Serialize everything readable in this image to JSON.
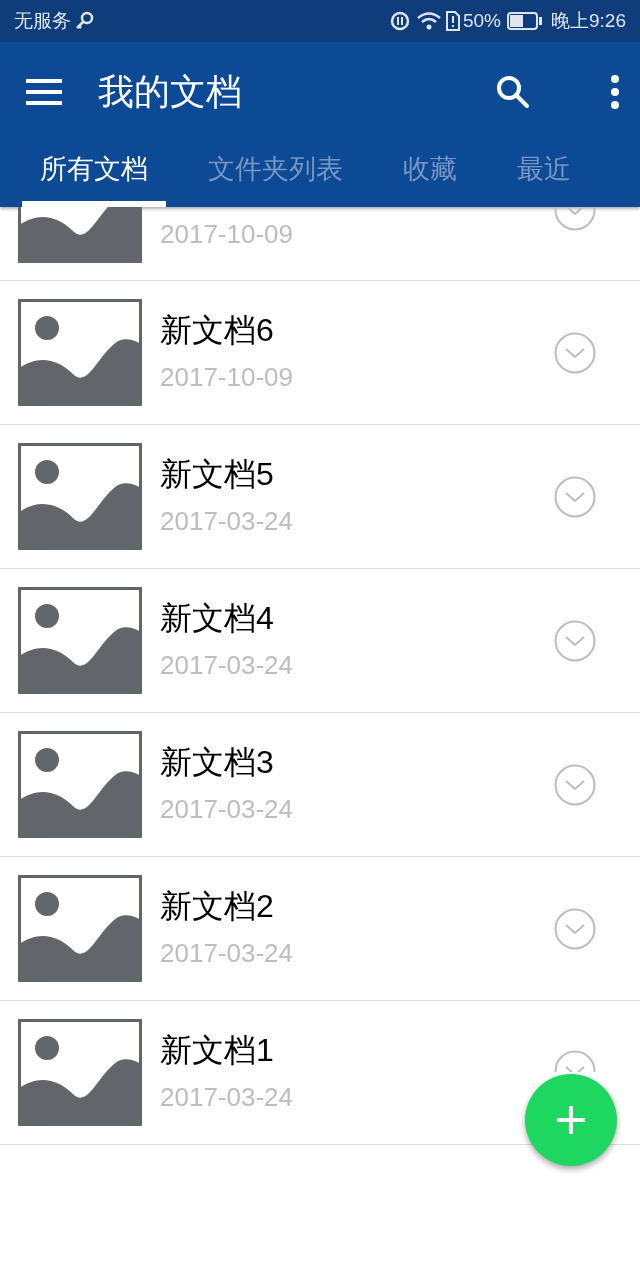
{
  "status_bar": {
    "carrier": "无服务",
    "battery": "50%",
    "time": "晚上9:26"
  },
  "app_bar": {
    "title": "我的文档"
  },
  "tabs": [
    {
      "label": "所有文档",
      "selected": true
    },
    {
      "label": "文件夹列表",
      "selected": false
    },
    {
      "label": "收藏",
      "selected": false
    },
    {
      "label": "最近",
      "selected": false
    }
  ],
  "documents": [
    {
      "kind": "partial",
      "date": "2017-10-09"
    },
    {
      "kind": "full",
      "title": "新文档6",
      "date": "2017-10-09"
    },
    {
      "kind": "full",
      "title": "新文档5",
      "date": "2017-03-24"
    },
    {
      "kind": "full",
      "title": "新文档4",
      "date": "2017-03-24"
    },
    {
      "kind": "full",
      "title": "新文档3",
      "date": "2017-03-24"
    },
    {
      "kind": "full",
      "title": "新文档2",
      "date": "2017-03-24"
    },
    {
      "kind": "full",
      "title": "新文档1",
      "date": "2017-03-24"
    }
  ]
}
